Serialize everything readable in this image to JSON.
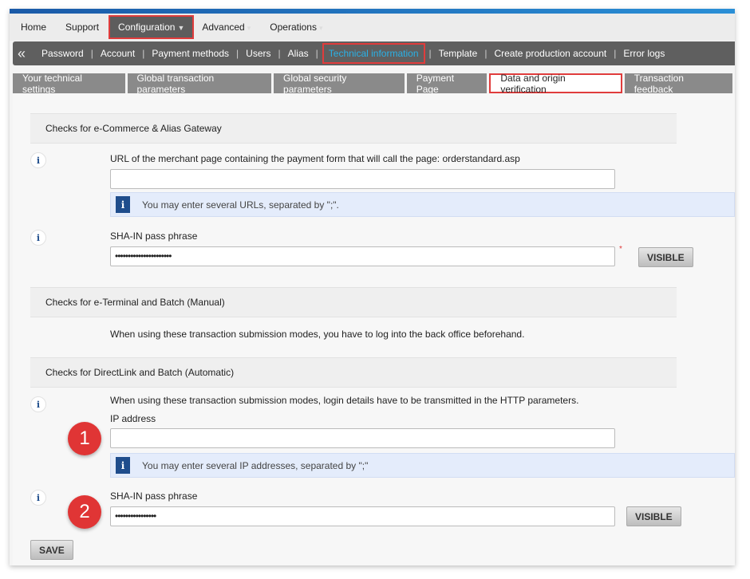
{
  "topnav": {
    "items": [
      "Home",
      "Support",
      "Configuration",
      "Advanced",
      "Operations"
    ]
  },
  "subnav": {
    "items": [
      "Password",
      "Account",
      "Payment methods",
      "Users",
      "Alias",
      "Technical information",
      "Template",
      "Create production account",
      "Error logs"
    ]
  },
  "tabs": [
    "Your technical settings",
    "Global transaction parameters",
    "Global security parameters",
    "Payment Page",
    "Data and origin verification",
    "Transaction feedback"
  ],
  "s1": {
    "title": "Checks for e-Commerce & Alias Gateway",
    "url_label": "URL of the merchant page containing the payment form that will call the page: orderstandard.asp",
    "url_value": "",
    "url_note": "You may enter several URLs, separated by \";\".",
    "sha_label": "SHA-IN pass phrase",
    "sha_value": "••••••••••••••••••••••",
    "required": "*",
    "visible_btn": "VISIBLE"
  },
  "s2": {
    "title": "Checks for e-Terminal and Batch (Manual)",
    "text": "When using these transaction submission modes, you have to log into the back office beforehand."
  },
  "s3": {
    "title": "Checks for DirectLink and Batch (Automatic)",
    "text": "When using these transaction submission modes, login details have to be transmitted in the HTTP parameters.",
    "ip_label": "IP address",
    "ip_value": "",
    "ip_note": "You may enter several IP addresses, separated by \";\"",
    "sha_label": "SHA-IN pass phrase",
    "sha_value": "••••••••••••••••",
    "visible_btn": "VISIBLE"
  },
  "info_glyph": "i",
  "badges": [
    "1",
    "2"
  ],
  "save": "SAVE"
}
